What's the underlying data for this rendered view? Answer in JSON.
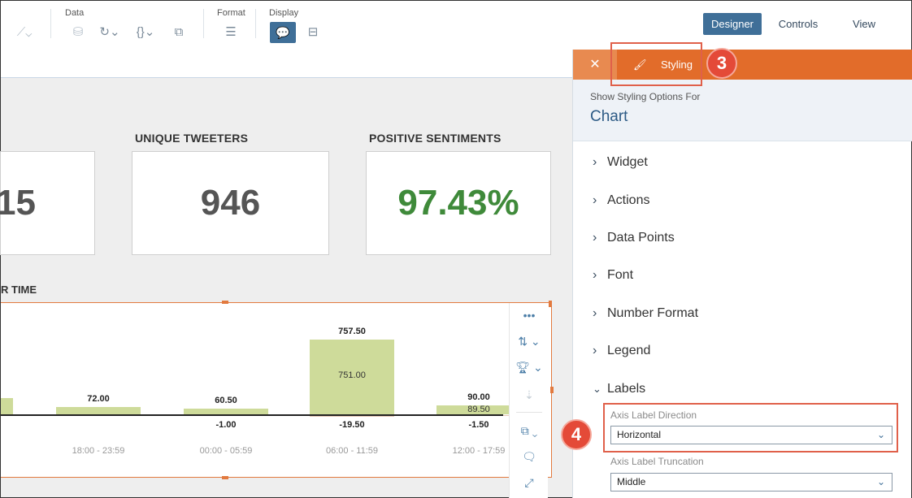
{
  "toolbar": {
    "groups": {
      "data": "Data",
      "format": "Format",
      "display": "Display"
    },
    "modes": [
      "Designer",
      "Controls",
      "View"
    ],
    "active_mode": "Designer"
  },
  "kpis": [
    {
      "title": "",
      "value": "15",
      "color": "#555555"
    },
    {
      "title": "UNIQUE TWEETERS",
      "value": "946",
      "color": "#555555"
    },
    {
      "title": "POSITIVE SENTIMENTS",
      "value": "97.43%",
      "color": "#3f8a3a"
    }
  ],
  "chart": {
    "title": "R TIME"
  },
  "chart_data": {
    "type": "bar",
    "categories": [
      "",
      "18:00 - 23:59",
      "00:00 - 05:59",
      "06:00 - 11:59",
      "12:00 - 17:59"
    ],
    "series": [
      {
        "values": [
          null,
          72.0,
          60.5,
          751.0,
          89.5
        ]
      },
      {
        "values": [
          null,
          null,
          -1.0,
          -19.5,
          -1.5
        ]
      }
    ],
    "totals": [
      null,
      72.0,
      60.5,
      757.5,
      90.0
    ],
    "labels": {
      "positive": [
        "",
        "72.00",
        "60.50",
        "757.50",
        "90.00"
      ],
      "inner": [
        "",
        "",
        "",
        "751.00",
        "89.50"
      ],
      "negative": [
        "",
        "",
        "-1.00",
        "-19.50",
        "-1.50"
      ]
    }
  },
  "panel": {
    "tab_label": "Styling",
    "subtitle": "Show Styling Options For",
    "title": "Chart",
    "sections": [
      "Widget",
      "Actions",
      "Data Points",
      "Font",
      "Number Format",
      "Legend",
      "Labels"
    ],
    "axis_label_direction": {
      "label": "Axis Label Direction",
      "value": "Horizontal"
    },
    "axis_label_truncation": {
      "label": "Axis Label Truncation",
      "value": "Middle"
    }
  },
  "callouts": {
    "step3": "3",
    "step4": "4"
  },
  "colors": {
    "accent": "#e26c2a",
    "primary": "#3f6f98",
    "positive": "#3f8a3a",
    "bar": "#cedb9a",
    "highlight": "#e0604a"
  }
}
